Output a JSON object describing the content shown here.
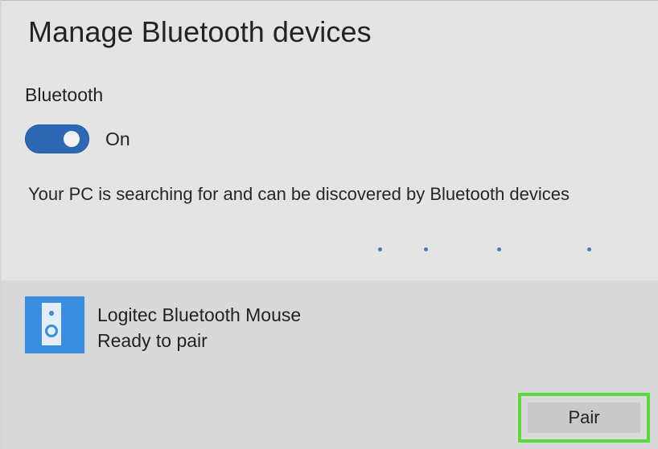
{
  "page": {
    "title": "Manage Bluetooth devices"
  },
  "bluetooth": {
    "label": "Bluetooth",
    "toggle_state": "On",
    "enabled": true,
    "status_text": "Your PC is searching for and can be discovered by Bluetooth devices"
  },
  "devices": [
    {
      "icon": "speaker-icon",
      "name": "Logitec Bluetooth Mouse",
      "status": "Ready to pair",
      "action_label": "Pair"
    }
  ],
  "colors": {
    "toggle_on": "#2d68b4",
    "device_icon_bg": "#3a8ee0",
    "highlight_outline": "#5bd93e",
    "progress_dots": "#4a78b8"
  }
}
